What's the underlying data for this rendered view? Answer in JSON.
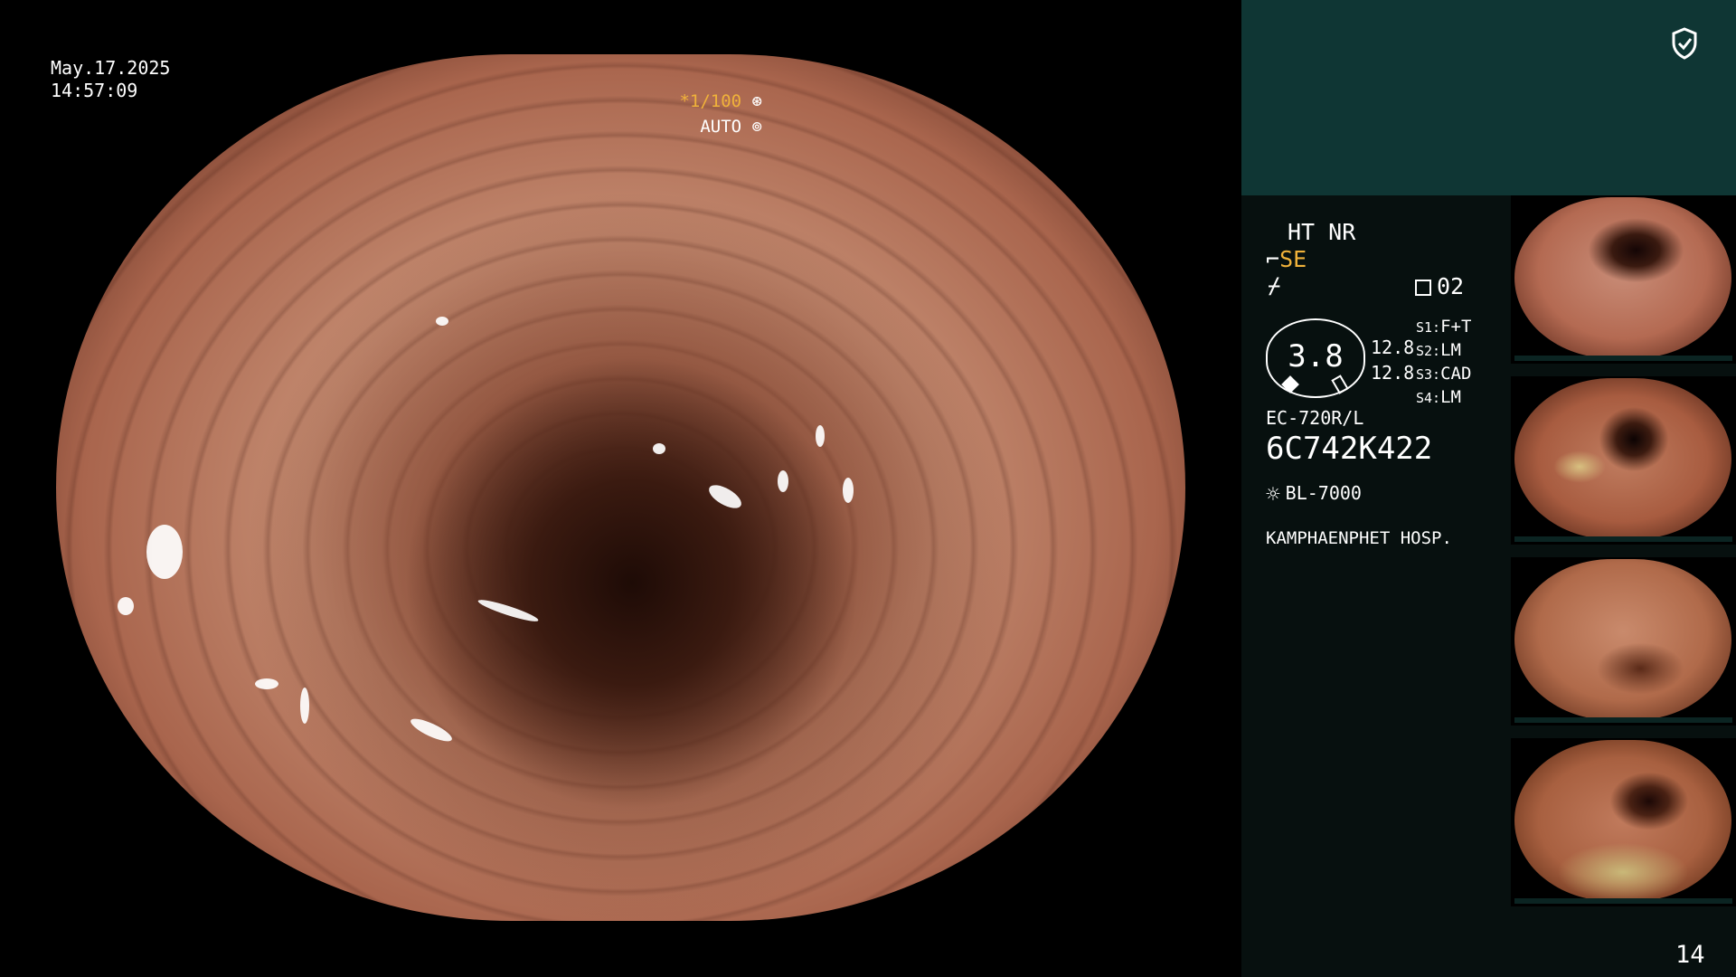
{
  "overlay": {
    "date": "May.17.2025",
    "time": "14:57:09",
    "shutter_speed": "*1/100",
    "exposure_mode": "AUTO"
  },
  "panel": {
    "ht_nr": "HT NR",
    "se_prefix": "⌐",
    "se_label": "SE",
    "squiggle": "⌿",
    "mode_value": "02",
    "gauge_value": "3.8",
    "gauge_side_values": [
      "12.8",
      "12.8"
    ],
    "settings": [
      {
        "key": "S1:",
        "value": "F+T"
      },
      {
        "key": "S2:",
        "value": "LM"
      },
      {
        "key": "S3:",
        "value": "CAD"
      },
      {
        "key": "S4:",
        "value": "LM"
      }
    ],
    "scope_model": "EC-720R/L",
    "scope_serial": "6C742K422",
    "light_source": "BL-7000",
    "hospital": "KAMPHAENPHET HOSP.",
    "page_number": "14"
  },
  "colors": {
    "accent": "#f0b23a",
    "panel_top": "#0f3634",
    "panel_bg": "#07100f"
  },
  "icons": [
    "shield-check-icon",
    "shutter-icon",
    "auto-exposure-icon",
    "sun-icon"
  ],
  "thumbnails_count": 4
}
